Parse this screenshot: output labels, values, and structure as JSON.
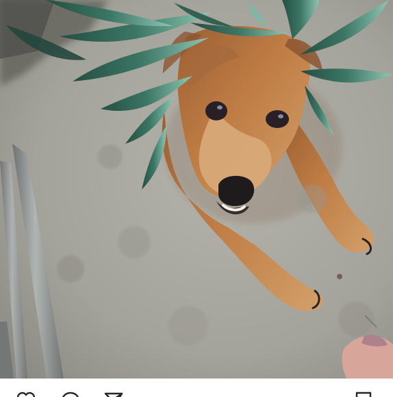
{
  "post": {
    "photo": {
      "alt": "",
      "colors": {
        "floor": "#a8a79f",
        "floor_shadow": "#8f8e88",
        "pole": "#8e9291",
        "dog": "#b97a45",
        "dog_light": "#d7a26c",
        "leaf": "#2f6552",
        "leaf_light": "#7bb8a4"
      }
    },
    "actions": [
      {
        "icon": "heart-icon",
        "name": "like"
      },
      {
        "icon": "comment-bubble-icon",
        "name": "comment"
      },
      {
        "icon": "send-icon",
        "name": "share"
      },
      {
        "icon": "bookmark-icon",
        "name": "save"
      }
    ]
  }
}
